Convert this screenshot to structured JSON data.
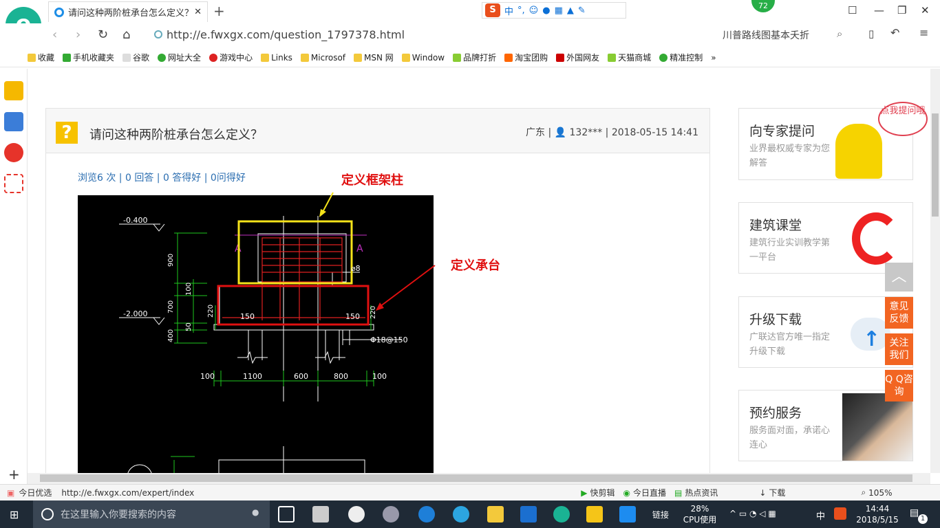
{
  "browser": {
    "tab_title": "请问这种两阶桩承台怎么定义？_",
    "url": "http://e.fwxgx.com/question_1797378.html",
    "search_hint": "川普路线图基本夭折",
    "badge_count": "72",
    "ime": {
      "logo": "S",
      "mode": "中",
      "punct": "°,"
    }
  },
  "bookmarks": [
    "收藏",
    "手机收藏夹",
    "谷歌",
    "网址大全",
    "游戏中心",
    "Links",
    "Microsof",
    "MSN 网",
    "Window",
    "品牌打折",
    "淘宝团购",
    "外国网友",
    "天猫商城",
    "精准控制"
  ],
  "question": {
    "title": "请问这种两阶桩承台怎么定义？",
    "meta": "广东 | 👤 132*** | 2018-05-15 14:41:4",
    "stats": "浏览6 次 | 0 回答 | 0 答得好 | 0问得好",
    "annotation_column": "定义框架柱",
    "annotation_cap": "定义承台"
  },
  "cad_labels": {
    "elev1": "-0.400",
    "elev2": "-2.000",
    "dim_900": "900",
    "dim_100": "100",
    "dim_700": "700",
    "dim_50": "50",
    "dim_400": "400",
    "dim_220a": "220",
    "dim_220b": "220",
    "dim_150a": "150",
    "dim_150b": "150",
    "bar": "⌀8",
    "rebar": "Φ18@150",
    "section_a": "A",
    "bottom_dims": [
      "100",
      "1100",
      "600",
      "800",
      "100"
    ]
  },
  "sidebar_cards": [
    {
      "title": "向专家提问",
      "desc": "业界最权威专家为您解答",
      "bubble": "点我提问哦"
    },
    {
      "title": "建筑课堂",
      "desc": "建筑行业实训教学第一平台"
    },
    {
      "title": "升级下载",
      "desc": "广联达官方唯一指定升级下载"
    },
    {
      "title": "预约服务",
      "desc": "服务面对面，承诺心连心"
    }
  ],
  "float_buttons": [
    "意见反馈",
    "关注我们",
    "Q Q咨询"
  ],
  "status_bar": {
    "left_label": "今日优选",
    "link": "http://e.fwxgx.com/expert/index",
    "items": [
      "快剪辑",
      "今日直播",
      "热点资讯",
      "下载"
    ],
    "zoom": "105%"
  },
  "taskbar": {
    "search_placeholder": "在这里输入你要搜索的内容",
    "link_label": "链接",
    "cpu_percent": "28%",
    "cpu_label": "CPU使用",
    "ime": "中",
    "time": "14:44",
    "date": "2018/5/15",
    "notif_count": "1"
  },
  "colors": {
    "accent": "#1ab394",
    "orange": "#f26522",
    "link": "#2a6db0"
  }
}
